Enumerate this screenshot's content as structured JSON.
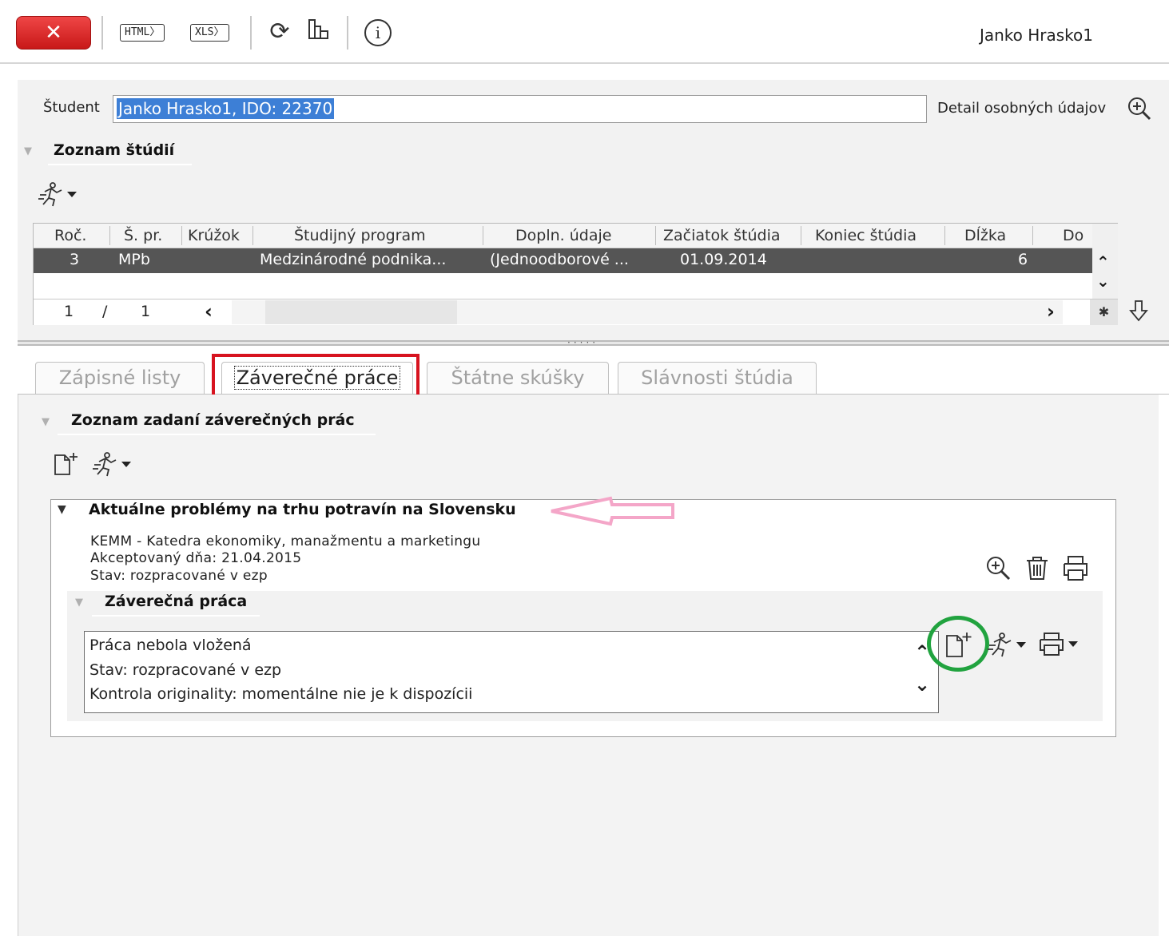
{
  "toolbar": {
    "close_label": "✕",
    "html_label": "HTML",
    "xls_label": "XLS",
    "user_name": "Janko Hrasko1"
  },
  "student": {
    "label": "Študent",
    "value": "Janko Hrasko1, IDO: 22370",
    "detail_link": "Detail osobných údajov"
  },
  "studies": {
    "title": "Zoznam štúdií",
    "columns": [
      "Roč.",
      "Š. pr.",
      "Krúžok",
      "Študijný program",
      "Dopln. údaje",
      "Začiatok štúdia",
      "Koniec štúdia",
      "Dĺžka",
      "Do"
    ],
    "rows": [
      {
        "roc": "3",
        "sp": "MPb",
        "kruzok": "",
        "program": "Medzinárodné podnika...",
        "doplnudaje": "(Jednoodborové ...",
        "zaciatok": "01.09.2014",
        "koniec": "",
        "dlzka": "6",
        "do": ""
      }
    ],
    "pager": {
      "current": "1",
      "separator": "/",
      "total": "1"
    }
  },
  "tabs": [
    {
      "label": "Zápisné listy",
      "active": false
    },
    {
      "label": "Záverečné práce",
      "active": true
    },
    {
      "label": "Štátne skúšky",
      "active": false
    },
    {
      "label": "Slávnosti štúdia",
      "active": false
    }
  ],
  "assignments": {
    "title": "Zoznam zadaní záverečných prác",
    "thesis": {
      "title": "Aktuálne problémy na trhu potravín na Slovensku",
      "department": "KEMM - Katedra ekonomiky, manažmentu a marketingu",
      "accepted": "Akceptovaný dňa: 21.04.2015",
      "state": "Stav: rozpracované v ezp",
      "final_work": {
        "title": "Záverečná práca",
        "lines": [
          "Práca nebola vložená",
          "Stav: rozpracované v ezp",
          "Kontrola originality: momentálne nie je k dispozícii"
        ]
      }
    }
  },
  "colors": {
    "close_red": "#d92a2a",
    "selection_blue": "#3d7fd6",
    "tab_highlight_red": "#d7131f",
    "annotation_green": "#21a33f",
    "annotation_pink": "#f4a6c8"
  }
}
